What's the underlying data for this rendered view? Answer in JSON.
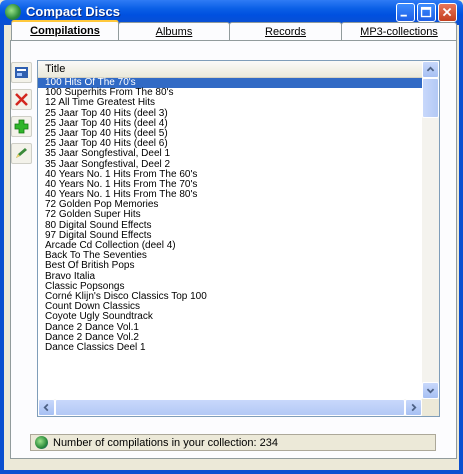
{
  "window": {
    "title": "Compact Discs",
    "accent_color": "#0a5fe6",
    "selection_color": "#316ac5"
  },
  "tabs": [
    {
      "label": "Compilations",
      "active": true
    },
    {
      "label": "Albums",
      "active": false
    },
    {
      "label": "Records",
      "active": false
    },
    {
      "label": "MP3-collections",
      "active": false
    }
  ],
  "toolbar": {
    "buttons": [
      {
        "icon": "properties-icon"
      },
      {
        "icon": "delete-icon"
      },
      {
        "icon": "add-icon"
      },
      {
        "icon": "edit-icon"
      }
    ]
  },
  "list": {
    "column_header": "Title",
    "selected_index": 0,
    "items": [
      "100 Hits Of The 70's",
      "100 Superhits From The 80's",
      "12 All Time Greatest Hits",
      "25 Jaar Top 40 Hits (deel 3)",
      "25 Jaar Top 40 Hits (deel 4)",
      "25 Jaar Top 40 Hits (deel 5)",
      "25 Jaar Top 40 Hits (deel 6)",
      "35 Jaar Songfestival, Deel 1",
      "35 Jaar Songfestival, Deel 2",
      "40 Years No. 1 Hits From The 60's",
      "40 Years No. 1 Hits From The 70's",
      "40 Years No. 1 Hits From The 80's",
      "72 Golden Pop Memories",
      "72 Golden Super Hits",
      "80 Digital Sound Effects",
      "97 Digital Sound Effects",
      "Arcade Cd Collection (deel 4)",
      "Back To The Seventies",
      "Best Of British Pops",
      "Bravo Italia",
      "Classic Popsongs",
      "Corné Klijn's Disco Classics Top 100",
      "Count Down Classics",
      "Coyote Ugly Soundtrack",
      "Dance 2 Dance Vol.1",
      "Dance 2 Dance Vol.2",
      "Dance Classics Deel 1"
    ]
  },
  "status": {
    "text": "Number of compilations in your collection: 234"
  }
}
